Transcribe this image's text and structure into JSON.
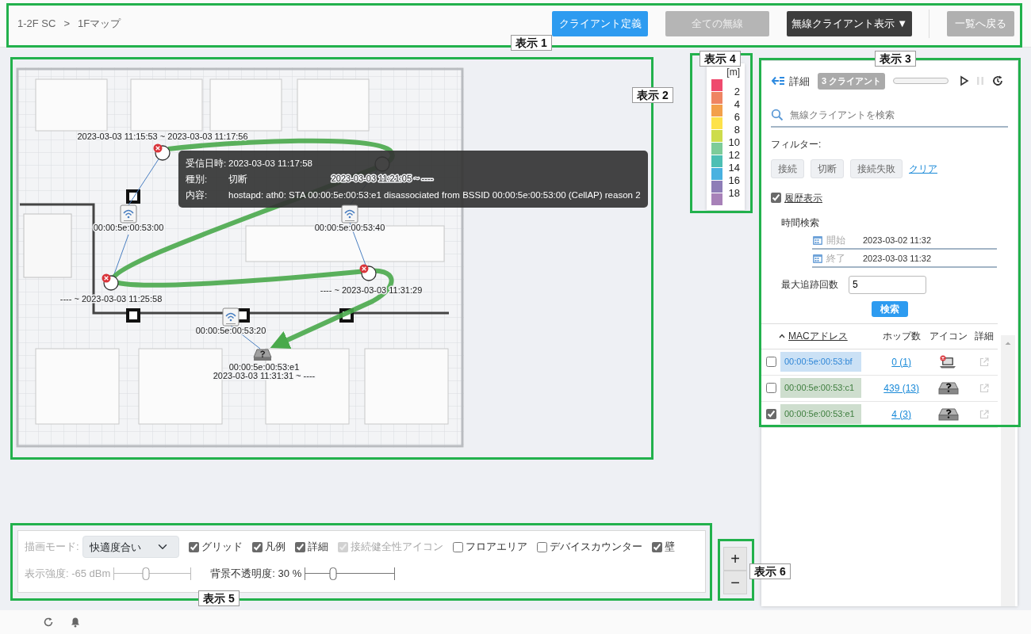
{
  "header": {
    "breadcrumb": [
      "1-2F SC",
      ">",
      "1Fマップ"
    ],
    "buttons": [
      {
        "label": "クライアント定義",
        "kind": "primary"
      },
      {
        "label": "全ての無線",
        "kind": "disabled"
      },
      {
        "label": "無線クライアント表示 ▼",
        "kind": "dark"
      },
      {
        "label": "一覧へ戻る",
        "kind": "secondary"
      }
    ]
  },
  "map": {
    "access_points": [
      {
        "mac": "00:00:5e:00:53:00"
      },
      {
        "mac": "00:00:5e:00:53:40"
      },
      {
        "mac": "00:00:5e:00:53:20"
      }
    ],
    "trace_points": [
      {
        "time_range": "2023-03-03 11:15:53 ~ 2023-03-03 11:17:56",
        "error": true
      },
      {
        "time_range": "2023-03-03 11:21:05 ~ ----",
        "error": false
      },
      {
        "time_range": "---- ~ 2023-03-03 11:25:58",
        "error": true
      },
      {
        "time_range": "---- ~ 2023-03-03 11:31:29",
        "error": true
      }
    ],
    "client": {
      "mac": "00:00:5e:00:53:e1",
      "time_range": "2023-03-03 11:31:31 ~ ----"
    },
    "tooltip": {
      "rows": [
        {
          "label": "受信日時:",
          "value": "2023-03-03 11:17:58"
        },
        {
          "label": "種別:",
          "value": "切断"
        },
        {
          "label": "内容:",
          "value": "hostapd: ath0: STA 00:00:5e:00:53:e1 disassociated from BSSID 00:00:5e:00:53:00 (CellAP) reason 2"
        }
      ]
    }
  },
  "legend": {
    "unit": "[m]",
    "swatches": [
      {
        "color": "#ef4a6e",
        "label": "2"
      },
      {
        "color": "#ef8462",
        "label": "4"
      },
      {
        "color": "#f3a04a",
        "label": "6"
      },
      {
        "color": "#fde24a",
        "label": "8"
      },
      {
        "color": "#cddc4c",
        "label": "10"
      },
      {
        "color": "#7dcc99",
        "label": "12"
      },
      {
        "color": "#4cbfb4",
        "label": "14"
      },
      {
        "color": "#49b1e0",
        "label": "16"
      },
      {
        "color": "#8e7db7",
        "label": "18"
      },
      {
        "color": "#a781b8"
      }
    ]
  },
  "panel": {
    "title": "詳細",
    "client_count": "3 クライアント",
    "playback": {
      "level": 0
    },
    "search": {
      "placeholder": "無線クライアントを検索"
    },
    "filter_label": "フィルター:",
    "filters": [
      "接続",
      "切断",
      "接続失敗"
    ],
    "clear_link": "クリア",
    "history": {
      "label": "履歴表示",
      "checked": true
    },
    "time_search": {
      "title": "時間検索",
      "start": {
        "label": "開始",
        "value": "2023-03-02 11:32"
      },
      "end": {
        "label": "終了",
        "value": "2023-03-03 11:32"
      }
    },
    "max_trace": {
      "label": "最大追跡回数",
      "value": "5"
    },
    "search_button": "検索",
    "table": {
      "columns": [
        "MACアドレス",
        "ホップ数",
        "アイコン",
        "詳細"
      ],
      "rows": [
        {
          "checked": false,
          "mac": "00:00:5e:00:53:bf",
          "color": "#2f86d6",
          "hops": "0 (1)",
          "kind": "laptop-error"
        },
        {
          "checked": false,
          "mac": "00:00:5e:00:53:c1",
          "color": "#3d7d3d",
          "hops": "439 (13)",
          "kind": "unknown"
        },
        {
          "checked": true,
          "mac": "00:00:5e:00:53:e1",
          "color": "#3d7d3d",
          "hops": "4 (3)",
          "kind": "unknown"
        }
      ]
    }
  },
  "controls": {
    "mode": {
      "label": "描画モード:",
      "value": "快適度合い",
      "disabled": true
    },
    "options": [
      {
        "label": "グリッド",
        "checked": true,
        "disabled": false
      },
      {
        "label": "凡例",
        "checked": true,
        "disabled": false
      },
      {
        "label": "詳細",
        "checked": true,
        "disabled": false
      },
      {
        "label": "接続健全性アイコン",
        "checked": true,
        "disabled": true
      },
      {
        "label": "フロアエリア",
        "checked": false,
        "disabled": false
      },
      {
        "label": "デバイスカウンター",
        "checked": false,
        "disabled": false
      },
      {
        "label": "壁",
        "checked": true,
        "disabled": false
      }
    ],
    "sliders": [
      {
        "label": "表示強度: -65 dBm",
        "level": 0.41,
        "disabled": true
      },
      {
        "label": "背景不透明度: 30 %",
        "level": 0.31,
        "disabled": false
      }
    ]
  },
  "zoom": [
    "+",
    "−"
  ],
  "annotations": [
    "表示 1",
    "表示 2",
    "表示 3",
    "表示 4",
    "表示 5",
    "表示 6"
  ]
}
